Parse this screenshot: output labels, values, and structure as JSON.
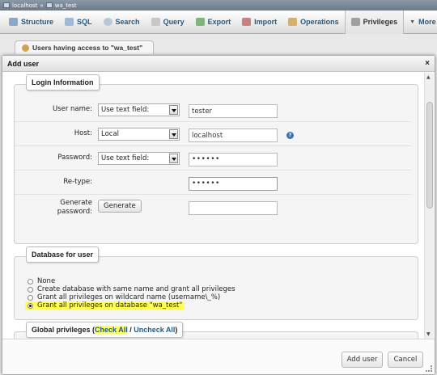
{
  "breadcrumb": {
    "server": "localhost",
    "sep": "»",
    "database": "wa_test"
  },
  "tabs": [
    {
      "label": "Structure",
      "color": "#8aa9c8"
    },
    {
      "label": "SQL",
      "color": "#9fb9d6"
    },
    {
      "label": "Search",
      "color": "#b9c7d6"
    },
    {
      "label": "Query",
      "color": "#c7c7c7"
    },
    {
      "label": "Export",
      "color": "#7fb37f"
    },
    {
      "label": "Import",
      "color": "#c98080"
    },
    {
      "label": "Operations",
      "color": "#d2b070"
    },
    {
      "label": "Privileges",
      "color": "#a0a0a0"
    },
    {
      "label": "More",
      "color": "#555555"
    }
  ],
  "subtab": {
    "label": "Users having access to \"wa_test\""
  },
  "dialog": {
    "title": "Add user",
    "close": "×",
    "login": {
      "legend": "Login Information",
      "username_label": "User name:",
      "username_select": "Use text field:",
      "username_value": "tester",
      "host_label": "Host:",
      "host_select": "Local",
      "host_value": "localhost",
      "help": "?",
      "password_label": "Password:",
      "password_select": "Use text field:",
      "password_value": "••••••",
      "retype_label": "Re-type:",
      "retype_value": "••••••",
      "generate_label_1": "Generate",
      "generate_label_2": "password:",
      "generate_button": "Generate",
      "generated_value": ""
    },
    "database": {
      "legend": "Database for user",
      "options": [
        {
          "label": "None",
          "selected": false
        },
        {
          "label": "Create database with same name and grant all privileges",
          "selected": false
        },
        {
          "label": "Grant all privileges on wildcard name (username\\_%)",
          "selected": false
        },
        {
          "label": "Grant all privileges on database \"wa_test\"",
          "selected": true
        }
      ]
    },
    "global": {
      "legend_prefix": "Global privileges (",
      "check_all": "Check All",
      "separator": " / ",
      "uncheck_all": "Uncheck All",
      "legend_suffix": ")"
    },
    "footer": {
      "add_user": "Add user",
      "cancel": "Cancel"
    }
  }
}
